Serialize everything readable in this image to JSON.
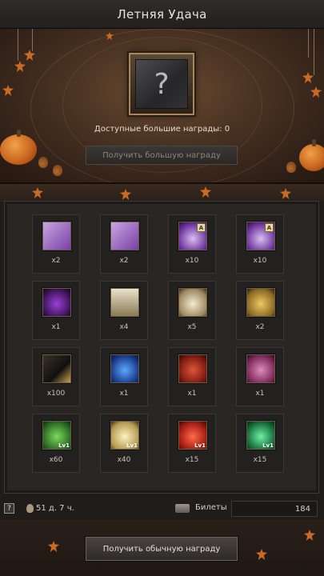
{
  "window": {
    "title": "Летняя Удача"
  },
  "big_reward": {
    "available_label": "Доступные большие награды: 0",
    "frame_symbol": "?",
    "get_button_label": "Получить большую награду"
  },
  "rewards": [
    {
      "icon": "purple-scroll-icon",
      "qty": "x2",
      "lv": "",
      "tag": ""
    },
    {
      "icon": "purple-scroll-icon",
      "qty": "x2",
      "lv": "",
      "tag": ""
    },
    {
      "icon": "purple-pouch-icon",
      "qty": "x10",
      "lv": "",
      "tag": "A"
    },
    {
      "icon": "purple-pouch-icon",
      "qty": "x10",
      "lv": "",
      "tag": "A"
    },
    {
      "icon": "purple-cauldron-icon",
      "qty": "x1",
      "lv": "",
      "tag": ""
    },
    {
      "icon": "warrior-chest-icon",
      "qty": "x4",
      "lv": "",
      "tag": ""
    },
    {
      "icon": "silver-ore-icon",
      "qty": "x5",
      "lv": "",
      "tag": ""
    },
    {
      "icon": "gold-ore-icon",
      "qty": "x2",
      "lv": "",
      "tag": ""
    },
    {
      "icon": "black-gold-bag-icon",
      "qty": "x100",
      "lv": "",
      "tag": ""
    },
    {
      "icon": "blue-chest-icon",
      "qty": "x1",
      "lv": "",
      "tag": ""
    },
    {
      "icon": "red-chest-icon",
      "qty": "x1",
      "lv": "",
      "tag": ""
    },
    {
      "icon": "pink-chest-icon",
      "qty": "x1",
      "lv": "",
      "tag": ""
    },
    {
      "icon": "green-rune-icon",
      "qty": "x60",
      "lv": "Lv1",
      "tag": ""
    },
    {
      "icon": "white-rune-icon",
      "qty": "x40",
      "lv": "Lv1",
      "tag": ""
    },
    {
      "icon": "red-rune-icon",
      "qty": "x15",
      "lv": "Lv1",
      "tag": ""
    },
    {
      "icon": "emerald-rune-icon",
      "qty": "x15",
      "lv": "Lv1",
      "tag": ""
    }
  ],
  "status": {
    "info_symbol": "?",
    "timer": "51 д. 7 ч.",
    "tickets_label": "Билеты",
    "tickets_value": "184"
  },
  "actions": {
    "get_normal_label": "Получить обычную награду"
  },
  "colors": {
    "accent_gold": "#a8875c",
    "leaf_orange": "#c96a25",
    "panel_bg": "#292624"
  }
}
